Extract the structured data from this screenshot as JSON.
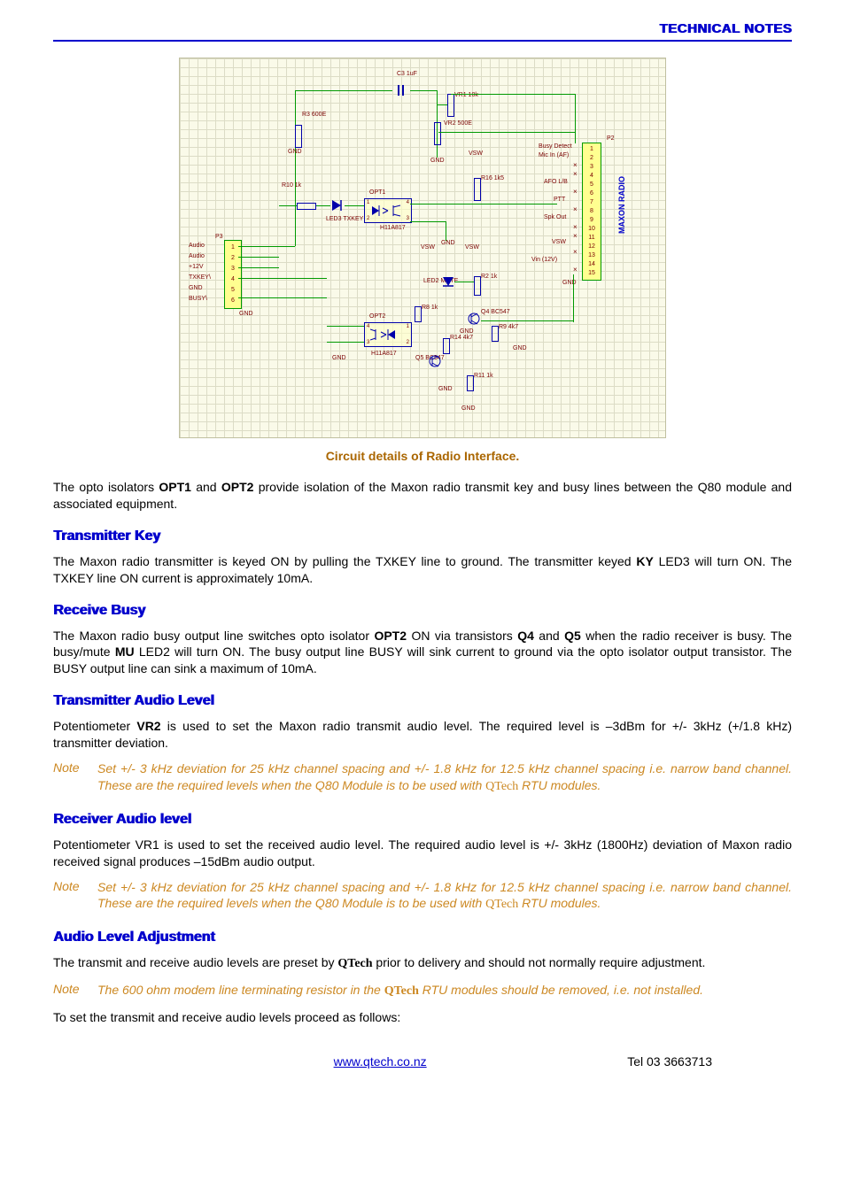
{
  "header_title": "TECHNICAL NOTES",
  "diagram": {
    "caption": "Circuit details of Radio Interface.",
    "maxon_label": "MAXON RADIO",
    "p3_label": "P3",
    "p3_pins": [
      "Audio",
      "Audio",
      "+12V",
      "TXKEY\\",
      "GND",
      "BUSY\\"
    ],
    "p2_label": "P2",
    "p2_signals": [
      "Busy Detect",
      "Mic In (AF)",
      "",
      "",
      "AFO L/B",
      "",
      "PTT",
      "",
      "Spk Out",
      "",
      "",
      "VSW",
      "",
      "Vin (12V)",
      ""
    ],
    "labels": {
      "c3": "C3\n1uF",
      "r3": "R3\n600E",
      "GND": "GND",
      "VSW": "VSW",
      "r10": "R10\n1k",
      "OPT1": "OPT1",
      "led3": "LED3\nTXKEY",
      "H11A817_1": "H11A817",
      "led2": "LED2\nMUTE",
      "OPT2": "OPT2",
      "H11A817_2": "H11A817",
      "r8": "R8\n1k",
      "r14": "R14\n4k7",
      "q5": "Q5\nBC547",
      "q4": "Q4\nBC547",
      "r9": "R9\n4k7",
      "r11": "R11\n1k",
      "vr1": "VR1\n10k",
      "vr2": "VR2\n500E",
      "r16": "R16\n1k5",
      "r2": "R2\n1k"
    }
  },
  "intro_paragraph_1": "The opto isolators ",
  "intro_opt1": "OPT1",
  "intro_mid1": " and ",
  "intro_opt2": "OPT2",
  "intro_paragraph_2": " provide isolation of the Maxon radio transmit key and busy lines between the Q80 module and associated equipment.",
  "tx_key": {
    "heading": "Transmitter Key",
    "p1_a": "The Maxon radio transmitter is keyed ON by pulling the TXKEY line to ground.  The transmitter keyed ",
    "p1_bold": "KY",
    "p1_b": " LED3 will turn ON.  The TXKEY line ON current is approximately 10mA."
  },
  "rx_busy": {
    "heading": "Receive Busy",
    "p1_a": "The Maxon radio busy output line switches opto isolator ",
    "p1_b1": "OPT2",
    "p1_mid1": " ON via transistors ",
    "p1_b2": "Q4",
    "p1_mid2": " and ",
    "p1_b3": "Q5",
    "p1_c": " when the radio receiver is busy.  The busy/mute ",
    "p1_b4": "MU",
    "p1_d": " LED2 will turn ON.  The busy output line BUSY will sink current to ground via the opto isolator output transistor.  The BUSY output line can sink a maximum of 10mA."
  },
  "tx_audio": {
    "heading": "Transmitter Audio Level",
    "p1_a": "Potentiometer ",
    "p1_b": "VR2",
    "p1_c": " is used to set the Maxon radio transmit audio level.  The required level is –3dBm for +/- 3kHz (+/1.8 kHz) transmitter deviation.",
    "note_label": "Note",
    "note_body_a": "Set +/- 3 kHz deviation for 25 kHz channel spacing and +/- 1.8 kHz for 12.5 kHz channel spacing i.e. narrow band channel.  These are the required levels when the Q80 Module is to be used with ",
    "note_brand": "QTech",
    "note_body_b": " RTU modules."
  },
  "rx_audio": {
    "heading": "Receiver Audio level",
    "p1": "Potentiometer VR1 is used to set the received audio level.  The required audio level is +/- 3kHz (1800Hz) deviation of Maxon radio received signal produces –15dBm audio output.",
    "note_label": "Note",
    "note_body_a": "Set +/- 3 kHz deviation for 25 kHz channel spacing and +/- 1.8 kHz for 12.5 kHz channel spacing i.e. narrow band channel.  These are the required levels when the Q80 Module is to be used with ",
    "note_brand": "QTech",
    "note_body_b": " RTU modules."
  },
  "adjust": {
    "heading": "Audio Level Adjustment",
    "p1_a": "The transmit and receive audio levels are preset by ",
    "p1_brand": "QTech",
    "p1_b": " prior to delivery and should not normally require adjustment.",
    "note_label": "Note",
    "note_body_a": "The 600 ohm modem line terminating resistor in the ",
    "note_brand": "QTech",
    "note_body_b": " RTU modules should be removed, i.e. not installed.",
    "p2": "To set the transmit and receive audio levels proceed as follows:"
  },
  "footer": {
    "url": "www.qtech.co.nz",
    "tel": "Tel 03 3663713"
  }
}
